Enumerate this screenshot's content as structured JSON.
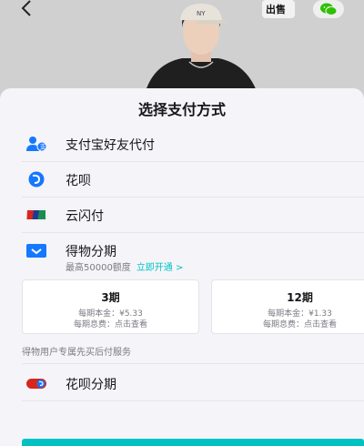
{
  "header": {
    "back_glyph": "<",
    "sell_label": "出售",
    "share_icon": "wechat-icon"
  },
  "sheet": {
    "title": "选择支付方式",
    "methods": [
      {
        "label": "支付宝好友代付",
        "icon": "alipay-friend-icon"
      },
      {
        "label": "花呗",
        "icon": "huabei-icon"
      },
      {
        "label": "云闪付",
        "icon": "unionpay-icon"
      },
      {
        "label": "得物分期",
        "icon": "dewu-installment-icon"
      }
    ],
    "installment": {
      "sub_text": "最高50000额度",
      "activate_link": "立即开通 >",
      "plans": [
        {
          "title": "3期",
          "principal": "每期本金：¥5.33",
          "fee": "每期息费：点击查看"
        },
        {
          "title": "12期",
          "principal": "每期本金：¥1.33",
          "fee": "每期息费：点击查看"
        }
      ]
    },
    "hint": "得物用户专属先买后付服务",
    "huabei_installment": {
      "label": "花呗分期",
      "icon": "huabei-installment-icon"
    }
  },
  "colors": {
    "accent": "#01c2c3",
    "icon_blue": "#1677ff",
    "unionpay_red": "#d7261e",
    "unionpay_green": "#1a8c55"
  }
}
